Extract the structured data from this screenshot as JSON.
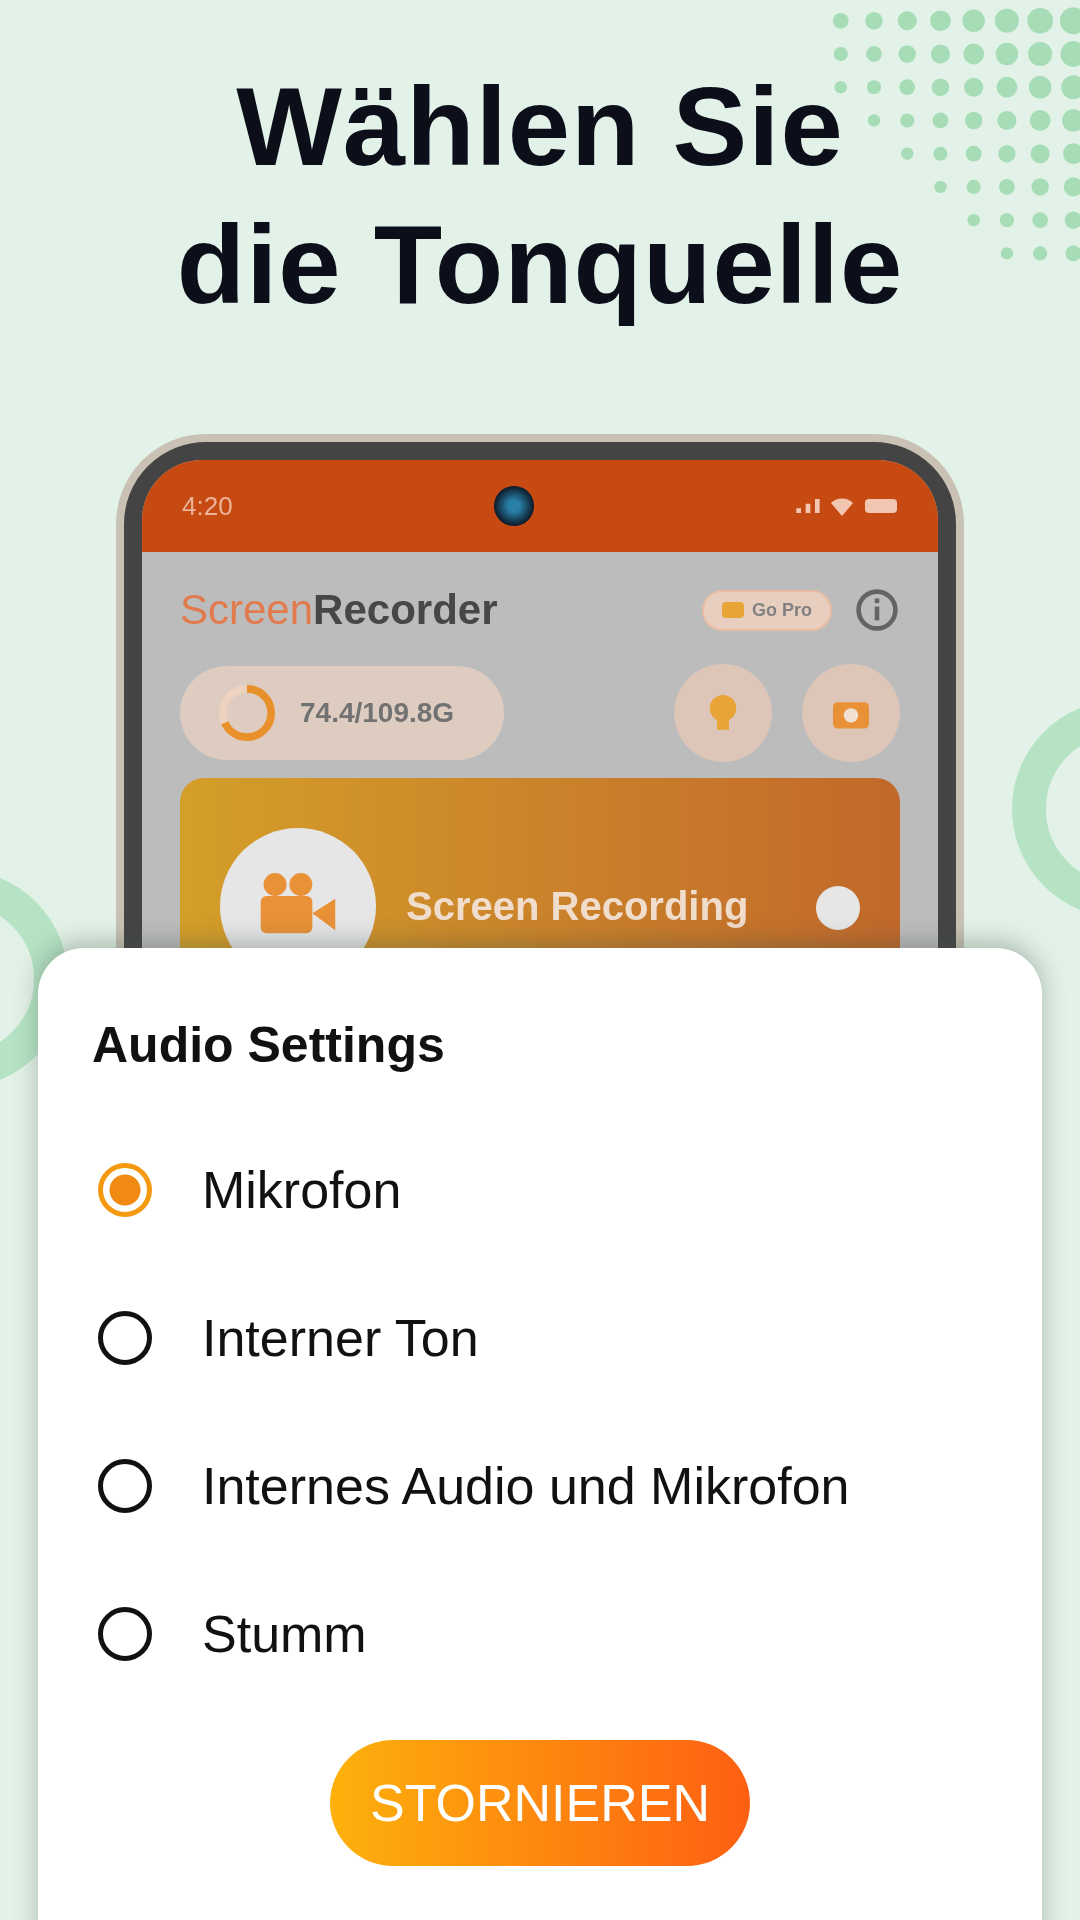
{
  "headline": [
    "Wählen Sie",
    "die Tonquelle"
  ],
  "phone": {
    "status_time": "4:20",
    "app_title": {
      "first": "Screen",
      "second": "Recorder"
    },
    "go_pro": "Go Pro",
    "storage": {
      "level": 0.68,
      "reading": "74.4/109.8G"
    },
    "card_title": "Screen Recording"
  },
  "sheet": {
    "title": "Audio Settings",
    "options": [
      {
        "label": "Mikrofon",
        "selected": true
      },
      {
        "label": "Interner Ton",
        "selected": false
      },
      {
        "label": "Internes Audio und Mikrofon",
        "selected": false
      },
      {
        "label": "Stumm",
        "selected": false
      }
    ],
    "cancel_button": "STORNIEREN"
  }
}
